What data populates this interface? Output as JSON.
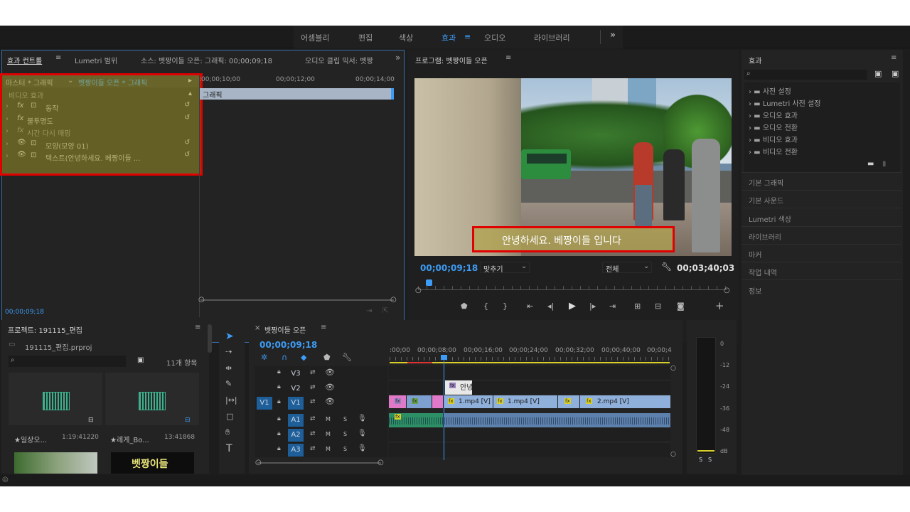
{
  "workspaces": [
    "어셈블리",
    "편집",
    "색상",
    "효과",
    "오디오",
    "라이브러리"
  ],
  "workspace_active_index": 3,
  "workspace_more": "»",
  "effect_controls": {
    "tabs": [
      "효과 컨트롤",
      "Lumetri 범위",
      "소스: 벳짱이들 오픈: 그래픽: 00;00;09;18",
      "오디오 클립 믹서: 벳짱"
    ],
    "master_label": "마스터 * 그래픽",
    "clip_label": "벳짱이들 오픈 * 그래픽",
    "section": "비디오 효과",
    "rows": [
      "동작",
      "불투명도",
      "시간 다시 매핑",
      "모양(모양 01)",
      "텍스트(안녕하세요. 베짱이들 ..."
    ],
    "ruler": [
      ":00;00;10;00",
      "00;00;12;00",
      "00;00;14;00"
    ],
    "clip_name": "그래픽",
    "timecode": "00;00;09;18"
  },
  "program": {
    "title": "프로그램: 벳짱이들 오픈",
    "caption": "안녕하세요. 베짱이들 입니다",
    "timecode": "00;00;09;18",
    "fit": "맞추기",
    "quality": "전체",
    "duration": "00;03;40;03"
  },
  "effects_panel": {
    "title": "효과",
    "items": [
      "사전 설정",
      "Lumetri 사전 설정",
      "오디오 효과",
      "오디오 전환",
      "비디오 효과",
      "비디오 전환"
    ],
    "sections": [
      "기본 그래픽",
      "기본 사운드",
      "Lumetri 색상",
      "라이브러리",
      "마커",
      "작업 내역",
      "정보"
    ]
  },
  "project": {
    "title": "프로젝트: 191115_편집",
    "file": "191115_편집.prproj",
    "count": "11개 항목",
    "items": [
      {
        "name": "★일상오...",
        "duration": "1:19:41220"
      },
      {
        "name": "★레게_Bo...",
        "duration": "13:41868"
      }
    ],
    "thumb_text": "벳짱이들"
  },
  "timeline": {
    "title": "벳짱이들 오픈",
    "timecode": "00;00;09;18",
    "ruler": [
      ":00;00",
      "00;00;08;00",
      "00;00;16;00",
      "00;00;24;00",
      "00;00;32;00",
      "00;00;40;00",
      "00;00;4"
    ],
    "video_tracks": [
      "V3",
      "V2",
      "V1"
    ],
    "audio_tracks": [
      "A1",
      "A2",
      "A3"
    ],
    "source_v1": "V1",
    "clips": [
      "1.mp4 [V]",
      "1.mp4 [V]",
      "2.mp4 [V]"
    ],
    "graphic_clip": "안녕"
  },
  "meter": {
    "labels": [
      "0",
      "-12",
      "-24",
      "-36",
      "-48",
      "dB"
    ],
    "solo": [
      "S",
      "S"
    ]
  },
  "colors": {
    "accent": "#2d8ceb",
    "red": "#e00000",
    "clip_blue": "#8fb0da",
    "clip_pink": "#e079c8",
    "audio_green": "#2d8f66"
  }
}
